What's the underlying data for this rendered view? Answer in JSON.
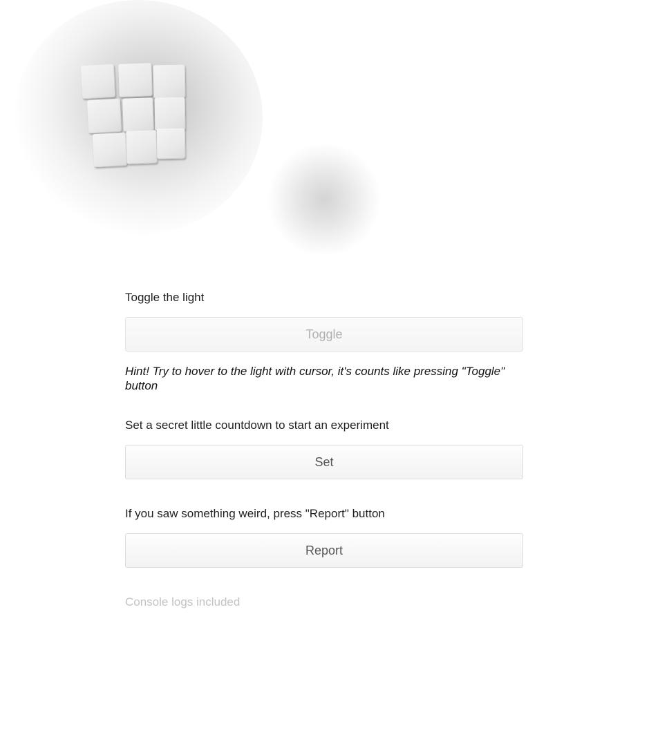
{
  "scene": {
    "cube_icon": "cube-grid-3x3",
    "light_icon": "light-blob"
  },
  "toggle_section": {
    "label": "Toggle the light",
    "button_label": "Toggle",
    "hint": "Hint! Try to hover to the light with cursor, it's counts like pressing \"Toggle\" button"
  },
  "set_section": {
    "label": "Set a secret little countdown to start an experiment",
    "button_label": "Set"
  },
  "report_section": {
    "label": "If you saw something weird, press \"Report\" button",
    "button_label": "Report",
    "footnote": "Console logs included"
  }
}
